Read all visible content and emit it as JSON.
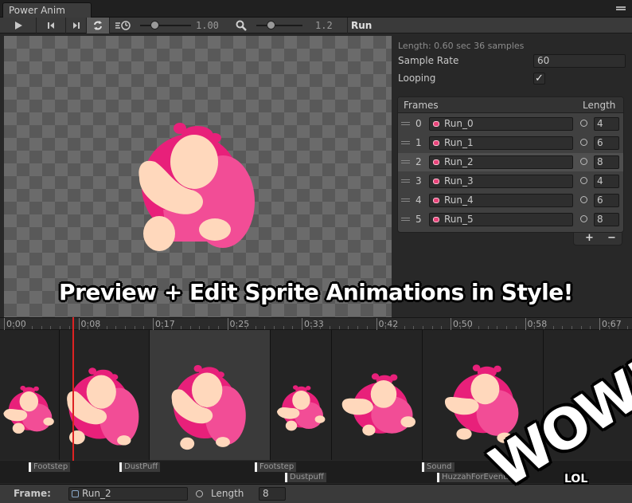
{
  "window": {
    "tab_title": "Power Anim"
  },
  "toolbar": {
    "speed_value": "1.00",
    "zoom_value": "1.2",
    "animation_name": "Run",
    "icons": [
      "play-icon",
      "step-back-icon",
      "step-forward-icon",
      "loop-icon",
      "speed-icon",
      "zoom-icon"
    ]
  },
  "banner": {
    "text": "Preview + Edit Sprite Animations in Style!"
  },
  "inspector": {
    "info": "Length: 0.60 sec  36 samples",
    "sample_rate_label": "Sample Rate",
    "sample_rate_value": "60",
    "looping_label": "Looping",
    "looping_checked": "✓"
  },
  "frames": {
    "header_label": "Frames",
    "length_header": "Length",
    "add_label": "+",
    "remove_label": "−",
    "rows": [
      {
        "index": "0",
        "sprite": "Run_0",
        "length": "4"
      },
      {
        "index": "1",
        "sprite": "Run_1",
        "length": "6"
      },
      {
        "index": "2",
        "sprite": "Run_2",
        "length": "8"
      },
      {
        "index": "3",
        "sprite": "Run_3",
        "length": "4"
      },
      {
        "index": "4",
        "sprite": "Run_4",
        "length": "6"
      },
      {
        "index": "5",
        "sprite": "Run_5",
        "length": "8"
      }
    ],
    "selected_index": 2
  },
  "timeline": {
    "ticks": [
      "0:00",
      "0:08",
      "0:17",
      "0:25",
      "0:33",
      "0:42",
      "0:50",
      "0:58",
      "0:67"
    ],
    "events": [
      {
        "label": "Footstep"
      },
      {
        "label": "DustPuff"
      },
      {
        "label": "Footstep"
      },
      {
        "label": "Dustpuff"
      },
      {
        "label": "Sound"
      },
      {
        "label": "HuzzahForEvents"
      }
    ]
  },
  "bottom": {
    "frame_label": "Frame:",
    "frame_sprite": "Run_2",
    "length_label": "Length",
    "length_value": "8"
  },
  "overlay": {
    "wow": "WOW!",
    "lol": "LOL"
  },
  "colors": {
    "sprite_dark_pink": "#e8207a",
    "sprite_pink": "#f24d96",
    "sprite_skin": "#ffd8bc",
    "playhead": "#dd2222"
  }
}
